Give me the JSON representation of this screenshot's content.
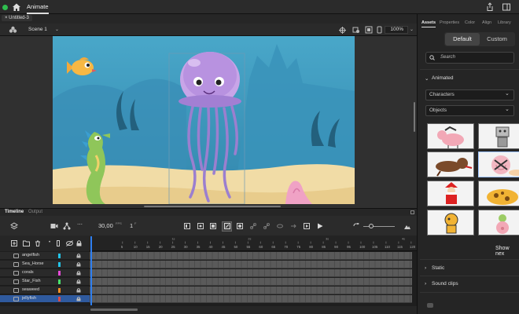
{
  "app": {
    "title": "Animate",
    "document": "Untitled-3"
  },
  "stage": {
    "scene": "Scene 1",
    "zoom": "100%"
  },
  "timeline": {
    "tabs": [
      "Timeline",
      "Output"
    ],
    "fps": "30,00",
    "fps_unit": "FPS",
    "frame": "1",
    "frame_unit": "F",
    "ruler": [
      "1s",
      "2s",
      "3s",
      "4s"
    ],
    "ticks": [
      "5",
      "10",
      "15",
      "20",
      "25",
      "30",
      "35",
      "40",
      "45",
      "50",
      "55",
      "60",
      "65",
      "70",
      "75",
      "80",
      "85",
      "90",
      "95",
      "100",
      "105",
      "110",
      "115",
      "120",
      "125"
    ],
    "layers": [
      {
        "name": "angelfish",
        "color": "#23c4e8"
      },
      {
        "name": "Sea_Horse",
        "color": "#23c4e8"
      },
      {
        "name": "corals",
        "color": "#e64ad8"
      },
      {
        "name": "Star_Fish",
        "color": "#48e06a"
      },
      {
        "name": "seaweed",
        "color": "#f58f25"
      },
      {
        "name": "jellyfish",
        "color": "#d94a4a"
      }
    ]
  },
  "panel": {
    "tabs": [
      "Assets",
      "Properties",
      "Color",
      "Align",
      "Library"
    ],
    "segments": {
      "default": "Default",
      "custom": "Custom"
    },
    "search_placeholder": "Search",
    "animated": "Animated",
    "characters": "Characters",
    "objects": "Objects",
    "show_next": "Show nex",
    "static": "Static",
    "sound_clips": "Sound clips"
  },
  "colors": {
    "accent": "#2f7ff0",
    "water": "#3f9ec2",
    "sand": "#f1dca6",
    "green_dot": "#2fbd4f"
  }
}
